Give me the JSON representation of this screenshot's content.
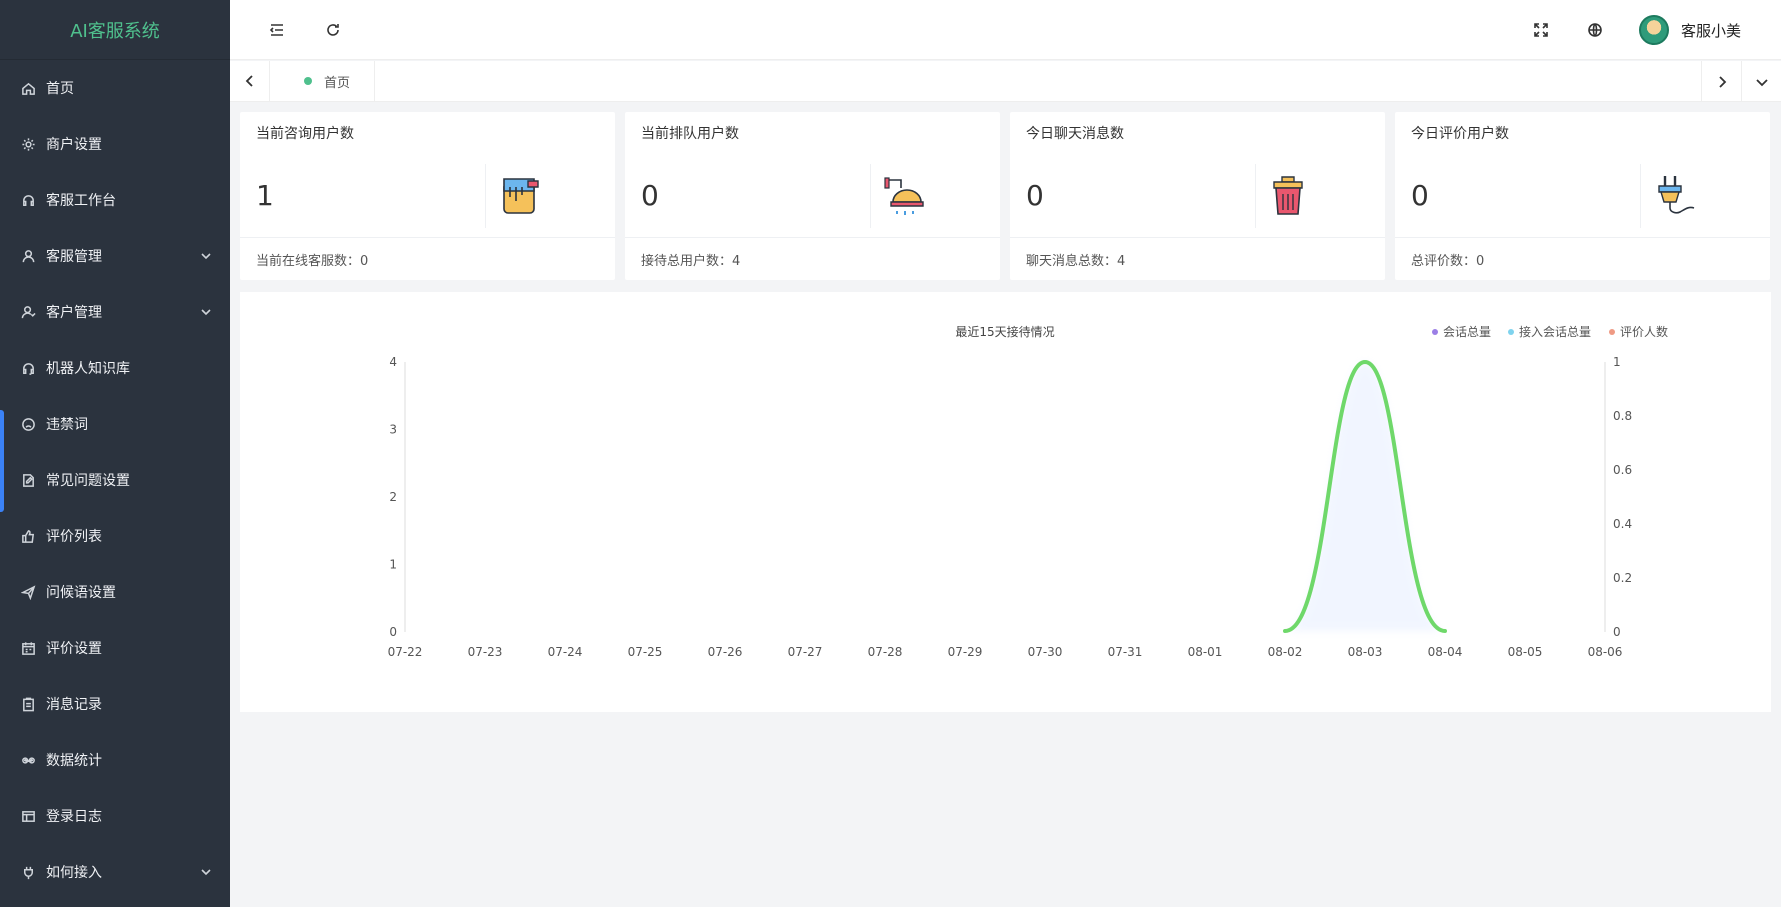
{
  "app": {
    "title": "AI客服系统"
  },
  "sidebar": {
    "items": [
      {
        "label": "首页",
        "icon": "home-icon"
      },
      {
        "label": "商户设置",
        "icon": "gear-icon"
      },
      {
        "label": "客服工作台",
        "icon": "headset-icon"
      },
      {
        "label": "客服管理",
        "icon": "user-icon",
        "has_children": true
      },
      {
        "label": "客户管理",
        "icon": "users-icon",
        "has_children": true
      },
      {
        "label": "机器人知识库",
        "icon": "robot-icon"
      },
      {
        "label": "违禁词",
        "icon": "frown-icon"
      },
      {
        "label": "常见问题设置",
        "icon": "edit-doc-icon"
      },
      {
        "label": "评价列表",
        "icon": "thumb-up-icon"
      },
      {
        "label": "问候语设置",
        "icon": "send-icon"
      },
      {
        "label": "评价设置",
        "icon": "calendar-icon"
      },
      {
        "label": "消息记录",
        "icon": "clipboard-icon"
      },
      {
        "label": "数据统计",
        "icon": "infinity-icon"
      },
      {
        "label": "登录日志",
        "icon": "window-icon"
      },
      {
        "label": "如何接入",
        "icon": "plug-icon",
        "has_children": true
      }
    ]
  },
  "header": {
    "username": "客服小美"
  },
  "tabs": [
    {
      "label": "首页",
      "active": true
    }
  ],
  "cards": [
    {
      "title": "当前咨询用户数",
      "value": "1",
      "footer": "当前在线客服数：0",
      "icon": "paint-bucket-icon"
    },
    {
      "title": "当前排队用户数",
      "value": "0",
      "footer": "接待总用户数：4",
      "icon": "shower-icon"
    },
    {
      "title": "今日聊天消息数",
      "value": "0",
      "footer": "聊天消息总数：4",
      "icon": "trash-bin-icon"
    },
    {
      "title": "今日评价用户数",
      "value": "0",
      "footer": "总评价数：0",
      "icon": "power-plug-icon"
    }
  ],
  "chart_data": {
    "type": "line",
    "title": "最近15天接待情况",
    "categories": [
      "07-22",
      "07-23",
      "07-24",
      "07-25",
      "07-26",
      "07-27",
      "07-28",
      "07-29",
      "07-30",
      "07-31",
      "08-01",
      "08-02",
      "08-03",
      "08-04",
      "08-05",
      "08-06"
    ],
    "series": [
      {
        "name": "会话总量",
        "values": [
          0,
          0,
          0,
          0,
          0,
          0,
          0,
          0,
          0,
          0,
          0,
          0,
          4,
          0,
          0,
          0
        ],
        "color": "#9b7fe6"
      },
      {
        "name": "接入会话总量",
        "values": [
          0,
          0,
          0,
          0,
          0,
          0,
          0,
          0,
          0,
          0,
          0,
          0,
          4,
          0,
          0,
          0
        ],
        "color": "#7fd3ee"
      },
      {
        "name": "评价人数",
        "values": [
          0,
          0,
          0,
          0,
          0,
          0,
          0,
          0,
          0,
          0,
          0,
          0,
          0,
          0,
          0,
          0
        ],
        "color": "#ef9a84",
        "axis": "right"
      }
    ],
    "y_left": {
      "min": 0,
      "max": 4,
      "ticks": [
        "0",
        "1",
        "2",
        "3",
        "4"
      ]
    },
    "y_right": {
      "min": 0,
      "max": 1,
      "ticks": [
        "0",
        "0.2",
        "0.4",
        "0.6",
        "0.8",
        "1"
      ]
    },
    "legend_position": "top-right",
    "line_color_visible": "#6fd86a",
    "grid": false
  }
}
